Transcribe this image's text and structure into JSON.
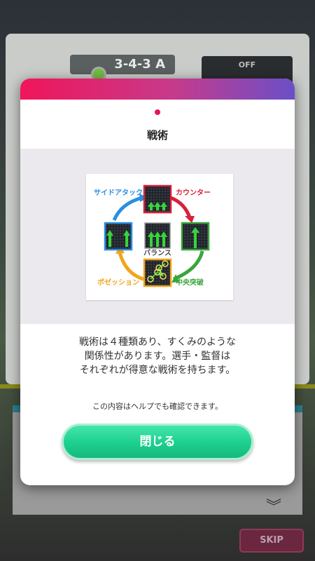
{
  "background": {
    "formation": "3-4-3 A",
    "panel_label": "OFF",
    "skip_label": "SKIP"
  },
  "modal": {
    "title": "戦術",
    "diagram": {
      "side_attack": "サイドアタック",
      "counter": "カウンター",
      "balance": "バランス",
      "possession": "ポゼッション",
      "central_break": "中央突破"
    },
    "description": [
      "戦術は４種類あり、すくみのような",
      "関係性があります。選手・監督は",
      "それぞれが得意な戦術を持ちます。"
    ],
    "note": "この内容はヘルプでも確認できます。",
    "close_label": "閉じる"
  },
  "colors": {
    "header_start": "#f0155a",
    "header_end": "#6a4fc8",
    "button": "#1ccf8e",
    "side_attack": "#2a8fe0",
    "counter": "#d8213a",
    "possession": "#f2a51c",
    "central_break": "#3aa53a"
  }
}
